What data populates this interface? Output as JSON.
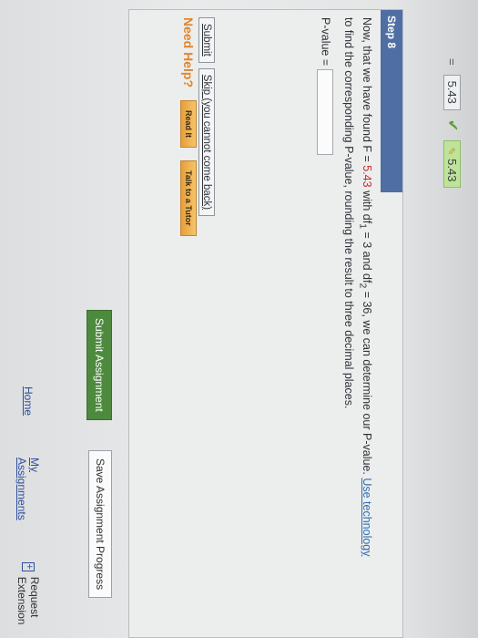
{
  "answer_row": {
    "equals": "=",
    "prev_value": "5.43",
    "status": "correct",
    "value": "5.43"
  },
  "step": {
    "title": "Step 8",
    "line1_part1": "Now, that we have found F = ",
    "f_value": "5.43",
    "line1_part2": " with df",
    "df1_sub": "1",
    "line1_part3": " = 3 and df",
    "df2_sub": "2",
    "line1_part4": " = 36, we can determine our P-value. ",
    "use_technology": "Use technology",
    "line2": "to find the corresponding P-value, rounding the result to three decimal places.",
    "pvalue_label": "P-value =",
    "pvalue_input": ""
  },
  "buttons": {
    "submit": "Submit",
    "skip": "Skip (you cannot come back)"
  },
  "help": {
    "label": "Need Help?",
    "read_it": "Read It",
    "talk_tutor": "Talk to a Tutor"
  },
  "footer": {
    "submit_assignment": "Submit Assignment",
    "save_progress": "Save Assignment Progress",
    "home": "Home",
    "my_assignments": "My Assignments",
    "request_extension": "Request Extension"
  },
  "colors": {
    "step_header": "#4f6fa4",
    "submit_green": "#4d8a3e",
    "help_orange": "#e0862f",
    "highlight_red": "#c62e2e"
  }
}
